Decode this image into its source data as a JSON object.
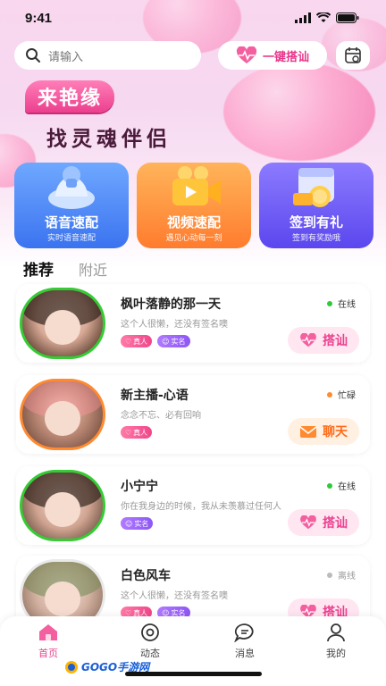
{
  "status_bar": {
    "time": "9:41"
  },
  "search": {
    "placeholder": "请输入"
  },
  "header": {
    "match_label": "一键搭讪"
  },
  "banner": {
    "tagline_top": "来艳缘",
    "tagline_bottom": "找灵魂伴侣"
  },
  "features": [
    {
      "title": "语音速配",
      "subtitle": "实时语音速配",
      "icon": "headset-icon"
    },
    {
      "title": "视频速配",
      "subtitle": "遇见心动每一刻",
      "icon": "video-camera-icon"
    },
    {
      "title": "签到有礼",
      "subtitle": "签到有奖励哦",
      "icon": "calendar-gift-icon"
    }
  ],
  "tabs": [
    {
      "label": "推荐",
      "active": true
    },
    {
      "label": "附近",
      "active": false
    }
  ],
  "users": [
    {
      "name": "枫叶落静的那一天",
      "signature": "这个人很懒，还没有签名噢",
      "status": "在线",
      "status_color": "#2fc93a",
      "tags": [
        "真人",
        "实名"
      ],
      "action": "搭讪",
      "action_type": "pink",
      "ring": "green"
    },
    {
      "name": "新主播-心语",
      "signature": "念念不忘、必有回响",
      "status": "忙碌",
      "status_color": "#ff8a30",
      "tags": [
        "真人"
      ],
      "action": "聊天",
      "action_type": "orange",
      "ring": "orange"
    },
    {
      "name": "小宁宁",
      "signature": "你在我身边的时候，我从未羡慕过任何人",
      "status": "在线",
      "status_color": "#2fc93a",
      "tags": [
        "实名"
      ],
      "action": "搭讪",
      "action_type": "pink",
      "ring": "green"
    },
    {
      "name": "白色风车",
      "signature": "这个人很懒，还没有签名噢",
      "status": "离线",
      "status_color": "#bbbbbb",
      "tags": [
        "真人",
        "实名"
      ],
      "action": "搭讪",
      "action_type": "pink",
      "ring": "none"
    }
  ],
  "bottom_nav": [
    {
      "label": "首页",
      "icon": "home-icon",
      "active": true
    },
    {
      "label": "动态",
      "icon": "moments-icon",
      "active": false
    },
    {
      "label": "消息",
      "icon": "message-icon",
      "active": false
    },
    {
      "label": "我的",
      "icon": "profile-icon",
      "active": false
    }
  ],
  "watermark": {
    "text": "GOGO手游网"
  },
  "colors": {
    "accent": "#ec3f8e",
    "online": "#2fc93a",
    "busy": "#ff8a30",
    "offline": "#bbbbbb"
  }
}
